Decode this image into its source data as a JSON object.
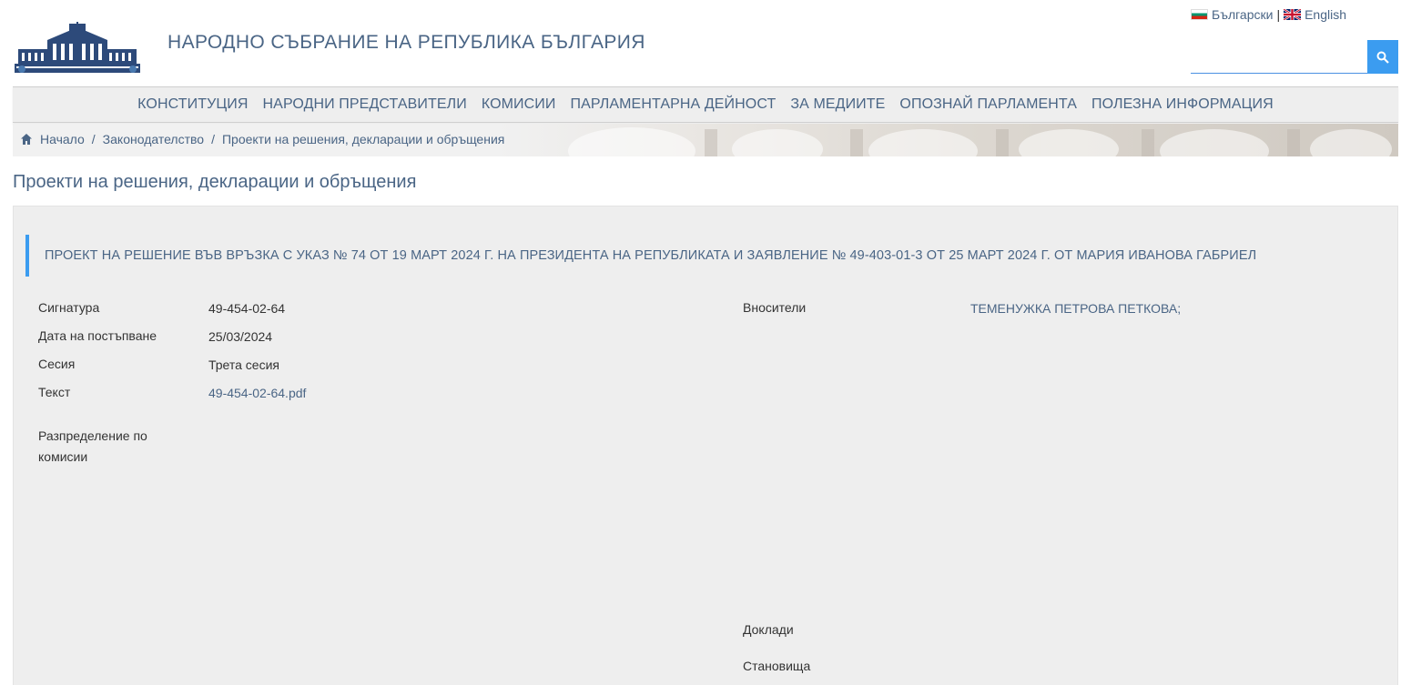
{
  "header": {
    "site_title": "НАРОДНО СЪБРАНИЕ НА РЕПУБЛИКА БЪЛГАРИЯ",
    "lang_bg": "Български",
    "lang_sep": "|",
    "lang_en": "English",
    "search_value": "",
    "icons": {
      "logo": "parliament-building-logo",
      "flag_bg": "bulgaria-flag-icon",
      "flag_en": "uk-flag-icon",
      "search": "search-icon"
    }
  },
  "nav": {
    "items": [
      {
        "label": "КОНСТИТУЦИЯ"
      },
      {
        "label": "НАРОДНИ ПРЕДСТАВИТЕЛИ"
      },
      {
        "label": "КОМИСИИ"
      },
      {
        "label": "ПАРЛАМЕНТАРНА ДЕЙНОСТ"
      },
      {
        "label": "ЗА МЕДИИТЕ"
      },
      {
        "label": "ОПОЗНАЙ ПАРЛАМЕНТА"
      },
      {
        "label": "ПОЛЕЗНА ИНФОРМАЦИЯ"
      }
    ]
  },
  "breadcrumb": {
    "sep": "/",
    "items": [
      {
        "label": "Начало"
      },
      {
        "label": "Законодателство"
      },
      {
        "label": "Проекти на решения, декларации и обръщения"
      }
    ]
  },
  "page": {
    "title": "Проекти на решения, декларации и обръщения"
  },
  "bill": {
    "title": "ПРОЕКТ НА РЕШЕНИЕ ВЪВ ВРЪЗКА С УКАЗ № 74 ОТ 19 МАРТ 2024 Г. НА ПРЕЗИДЕНТА НА РЕПУБЛИКАТА И ЗАЯВЛЕНИЕ № 49-403-01-3 ОТ 25 МАРТ 2024 Г. ОТ МАРИЯ ИВАНОВА ГАБРИЕЛ",
    "signature_label": "Сигнатура",
    "signature_value": "49-454-02-64",
    "date_label": "Дата на постъпване",
    "date_value": "25/03/2024",
    "session_label": "Сесия",
    "session_value": "Трета сесия",
    "text_label": "Текст",
    "text_value": "49-454-02-64.pdf",
    "distribution_label_1": "Разпределение по",
    "distribution_label_2": "комисии",
    "sponsors_label": "Вносители",
    "sponsors_value": "ТЕМЕНУЖКА ПЕТРОВА ПЕТКОВА;",
    "reports_label": "Доклади",
    "opinions_label": "Становища"
  },
  "colors": {
    "accent": "#3b9cf0",
    "link": "#4a6585",
    "panel_bg": "#eeeeee"
  }
}
